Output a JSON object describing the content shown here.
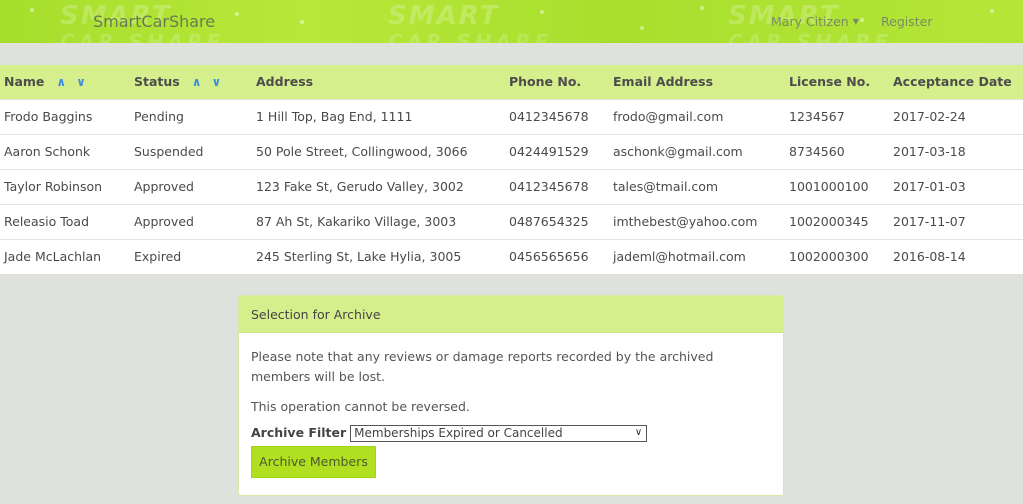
{
  "header": {
    "brand": "SmartCarShare",
    "user": "Mary Citizen",
    "register": "Register"
  },
  "table": {
    "columns": [
      "Name",
      "Status",
      "Address",
      "Phone No.",
      "Email Address",
      "License No.",
      "Acceptance Date"
    ],
    "sort_up": "∧",
    "sort_down": "∨",
    "rows": [
      [
        "Frodo Baggins",
        "Pending",
        "1 Hill Top, Bag End, 1111",
        "0412345678",
        "frodo@gmail.com",
        "1234567",
        "2017-02-24"
      ],
      [
        "Aaron Schonk",
        "Suspended",
        "50 Pole Street, Collingwood, 3066",
        "0424491529",
        "aschonk@gmail.com",
        "8734560",
        "2017-03-18"
      ],
      [
        "Taylor Robinson",
        "Approved",
        "123 Fake St, Gerudo Valley, 3002",
        "0412345678",
        "tales@tmail.com",
        "1001000100",
        "2017-01-03"
      ],
      [
        "Releasio Toad",
        "Approved",
        "87 Ah St, Kakariko Village, 3003",
        "0487654325",
        "imthebest@yahoo.com",
        "1002000345",
        "2017-11-07"
      ],
      [
        "Jade McLachlan",
        "Expired",
        "245 Sterling St, Lake Hylia, 3005",
        "0456565656",
        "jademl@hotmail.com",
        "1002000300",
        "2016-08-14"
      ]
    ]
  },
  "archive": {
    "title": "Selection for Archive",
    "note": "Please note that any reviews or damage reports recorded by the archived members will be lost.",
    "warning": "This operation cannot be reversed.",
    "filter_label": "Archive Filter",
    "filter_value": "Memberships Expired or Cancelled",
    "button": "Archive Members"
  },
  "colors": {
    "accent": "#b0e020",
    "header_row": "#d6ef8d",
    "sort_arrow": "#3a8edb"
  }
}
